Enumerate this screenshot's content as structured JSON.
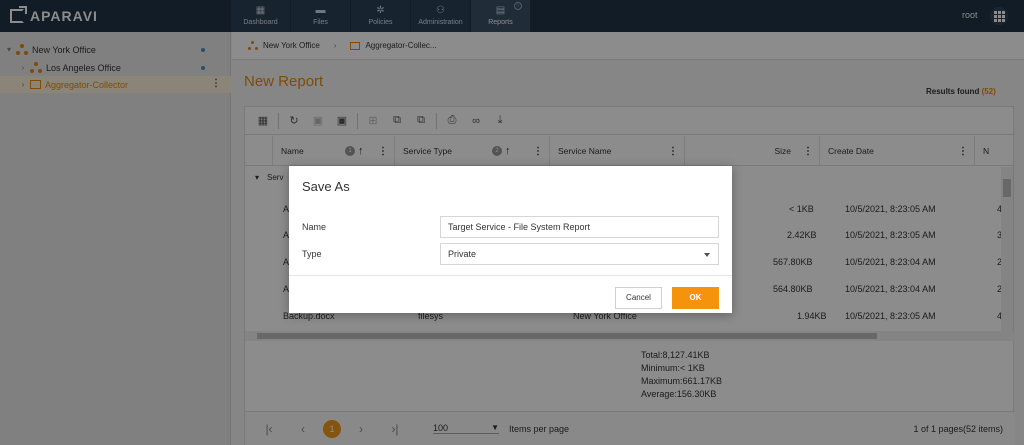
{
  "app": {
    "logo_text": "APARAVI"
  },
  "nav": {
    "items": [
      {
        "label": "Dashboard",
        "icon": "dashboard-icon"
      },
      {
        "label": "Files",
        "icon": "folder-icon"
      },
      {
        "label": "Policies",
        "icon": "gear-icon"
      },
      {
        "label": "Administration",
        "icon": "users-icon"
      },
      {
        "label": "Reports",
        "icon": "report-icon",
        "active": true
      }
    ],
    "user": "root"
  },
  "sidebar": {
    "items": [
      {
        "label": "New York Office",
        "caret": "▾"
      },
      {
        "label": "Los Angeles Office",
        "caret": "›"
      },
      {
        "label": "Aggregator-Collector",
        "caret": "›",
        "selected": true
      }
    ]
  },
  "breadcrumb": {
    "item1": "New York Office",
    "item2": "Aggregator-Collec..."
  },
  "page": {
    "title": "New Report",
    "results_label": "Results found",
    "results_count": "(52)"
  },
  "table": {
    "headers": [
      "Name",
      "Service Type",
      "Service Name",
      "Size",
      "Create Date",
      "N"
    ],
    "sort_badges": [
      "1",
      "2"
    ],
    "group_label": "Serv",
    "rows": [
      {
        "name": "A",
        "type": "",
        "service": "",
        "size": "< 1KB",
        "date": "10/5/2021, 8:23:05 AM",
        "n": "4"
      },
      {
        "name": "A",
        "type": "",
        "service": "",
        "size": "2.42KB",
        "date": "10/5/2021, 8:23:05 AM",
        "n": "3"
      },
      {
        "name": "A",
        "type": "",
        "service": "",
        "size": "567.80KB",
        "date": "10/5/2021, 8:23:04 AM",
        "n": "2"
      },
      {
        "name": "A",
        "type": "",
        "service": "",
        "size": "564.80KB",
        "date": "10/5/2021, 8:23:04 AM",
        "n": "2"
      },
      {
        "name": "Backup.docx",
        "type": "filesys",
        "service": "New York Office",
        "size": "1.94KB",
        "date": "10/5/2021, 8:23:05 AM",
        "n": "4"
      }
    ]
  },
  "totals": {
    "total": "Total:8,127.41KB",
    "minimum": "Minimum:< 1KB",
    "maximum": "Maximum:661.17KB",
    "average": "Average:156.30KB"
  },
  "pager": {
    "current": "1",
    "page_size": "100",
    "items_label": "Items per page",
    "summary": "1 of 1 pages(52 items)"
  },
  "dialog": {
    "title": "Save As",
    "name_label": "Name",
    "name_value": "Target Service - File System Report",
    "type_label": "Type",
    "type_value": "Private",
    "cancel": "Cancel",
    "ok": "OK"
  },
  "colors": {
    "accent": "#e8890c",
    "nav_bg": "#1f3347",
    "ok_button": "#f5930c"
  }
}
